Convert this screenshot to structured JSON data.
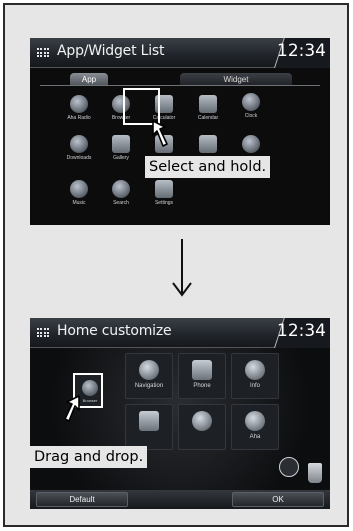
{
  "step1": {
    "title": "App/Widget List",
    "clock": "12:34",
    "tabs": [
      "App",
      "Widget"
    ],
    "apps": [
      "Aha Radio",
      "Browser",
      "Calculator",
      "Calendar",
      "Clock",
      "Downloads",
      "Gallery",
      "",
      "",
      "",
      "Music",
      "Search",
      "Settings"
    ],
    "callout": "Select and hold."
  },
  "step2": {
    "title": "Home customize",
    "clock": "12:34",
    "tiles": [
      "Navigation",
      "Phone",
      "Info",
      "Aha"
    ],
    "dragged_app": "Browser",
    "callout": "Drag and drop.",
    "page_indicator": {
      "pages": 5,
      "current": 4
    },
    "buttons": {
      "default": "Default",
      "ok": "OK"
    }
  }
}
